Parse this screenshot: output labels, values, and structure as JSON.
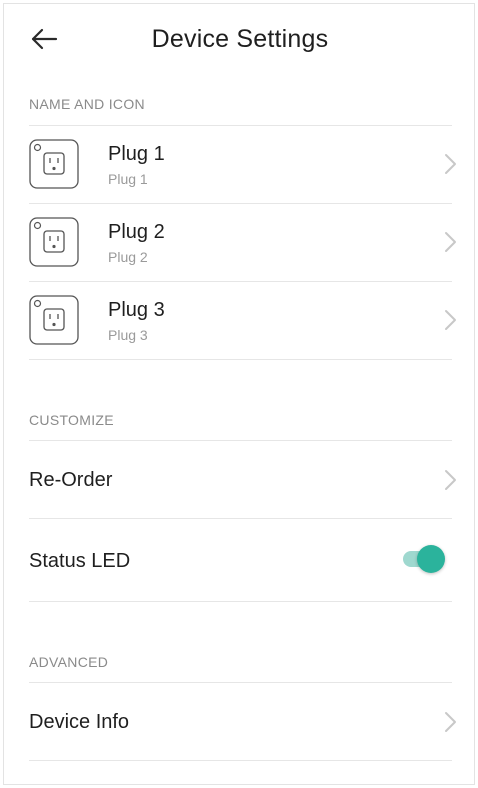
{
  "header": {
    "title": "Device Settings",
    "back_icon": "arrow-left-icon"
  },
  "sections": {
    "name_and_icon": {
      "title": "NAME AND ICON",
      "items": [
        {
          "name": "Plug 1",
          "subtitle": "Plug 1",
          "icon": "smart-plug-icon"
        },
        {
          "name": "Plug 2",
          "subtitle": "Plug 2",
          "icon": "smart-plug-icon"
        },
        {
          "name": "Plug 3",
          "subtitle": "Plug 3",
          "icon": "smart-plug-icon"
        }
      ]
    },
    "customize": {
      "title": "CUSTOMIZE",
      "reorder_label": "Re-Order",
      "status_led_label": "Status LED",
      "status_led_enabled": true
    },
    "advanced": {
      "title": "ADVANCED",
      "device_info_label": "Device Info"
    }
  },
  "colors": {
    "accent": "#2bb39c",
    "accent_track": "#9fd8cf",
    "divider": "#e6e6e6",
    "section_text": "#8a8a8a",
    "chevron": "#c8c8c8"
  }
}
